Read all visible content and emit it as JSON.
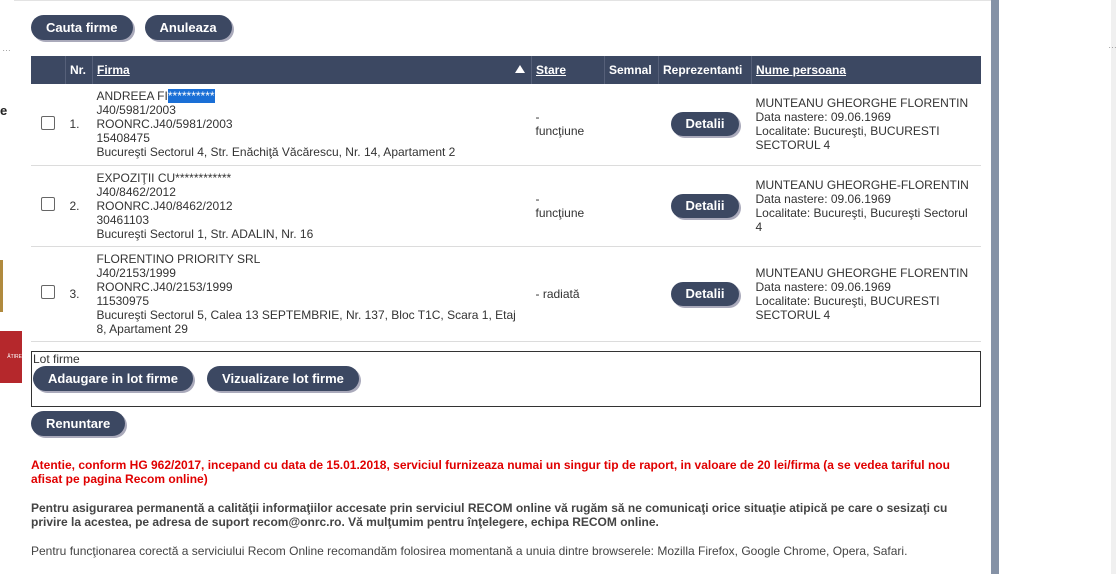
{
  "left_strip": {
    "letter": "e",
    "badge_text": "ĂTIRE"
  },
  "buttons": {
    "cauta": "Cauta firme",
    "anuleaza": "Anuleaza"
  },
  "table": {
    "headers": {
      "nr": "Nr.",
      "firma": "Firma",
      "stare": "Stare",
      "semnal": "Semnal",
      "reprezentanti": "Reprezentanti",
      "nume": "Nume persoana"
    },
    "sort_icon": "arrow-up-icon",
    "rows": [
      {
        "nr": "1.",
        "name_plain": "ANDREEA FI",
        "name_highlight": "**********",
        "reg": "J40/5981/2003",
        "euid": "ROONRC.J40/5981/2003",
        "cui": "15408475",
        "address": "Bucureşti Sectorul 4, Str. Enăchiţă Văcărescu, Nr. 14, Apartament 2",
        "stare_1": "-",
        "stare_2": "funcţiune",
        "detalii": "Detalii",
        "person": "MUNTEANU GHEORGHE FLORENTIN",
        "birth": "Data nastere: 09.06.1969",
        "locality": "Localitate: Bucureşti, BUCURESTI SECTORUL 4"
      },
      {
        "nr": "2.",
        "name_plain": "EXPOZIŢII CU************",
        "name_highlight": "",
        "reg": "J40/8462/2012",
        "euid": "ROONRC.J40/8462/2012",
        "cui": "30461103",
        "address": "Bucureşti Sectorul 1, Str. ADALIN, Nr. 16",
        "stare_1": "-",
        "stare_2": "funcţiune",
        "detalii": "Detalii",
        "person": "MUNTEANU GHEORGHE-FLORENTIN",
        "birth": "Data nastere: 09.06.1969",
        "locality": "Localitate: Bucureşti, Bucureşti Sectorul 4"
      },
      {
        "nr": "3.",
        "name_plain": "FLORENTINO PRIORITY SRL",
        "name_highlight": "",
        "reg": "J40/2153/1999",
        "euid": "ROONRC.J40/2153/1999",
        "cui": "11530975",
        "address": "Bucureşti Sectorul 5, Calea 13 SEPTEMBRIE, Nr. 137, Bloc T1C, Scara 1, Etaj 8, Apartament 29",
        "stare_1": "- radiată",
        "stare_2": "",
        "detalii": "Detalii",
        "person": "MUNTEANU GHEORGHE FLORENTIN",
        "birth": "Data nastere: 09.06.1969",
        "locality": "Localitate: Bucureşti, BUCURESTI SECTORUL 4"
      }
    ]
  },
  "lot": {
    "label": "Lot firme",
    "adaugare": "Adaugare in lot firme",
    "vizualizare": "Vizualizare lot firme"
  },
  "renuntare": "Renuntare",
  "notices": {
    "warning": "Atentie, conform HG 962/2017, incepand cu data de 15.01.2018, serviciul furnizeaza numai un singur tip de raport, in valoare de 20 lei/firma (a se vedea tariful nou afisat pe pagina Recom online)",
    "info": "Pentru asigurarea permanentă a calităţii informaţiilor accesate prin serviciul RECOM online vă rugăm să ne comunicaţi orice situaţie atipică pe care o sesizaţi cu privire la acestea, pe adresa de suport recom@onrc.ro. Vă mulţumim pentru înţelegere, echipa RECOM online.",
    "browsers": "Pentru funcţionarea corectă a serviciului Recom Online recomandăm folosirea momentană a unuia dintre browserele: Mozilla Firefox, Google Chrome, Opera, Safari."
  },
  "colors": {
    "header_bg": "#3c4862",
    "warning": "#e00000",
    "highlight": "#1a6fd6"
  }
}
